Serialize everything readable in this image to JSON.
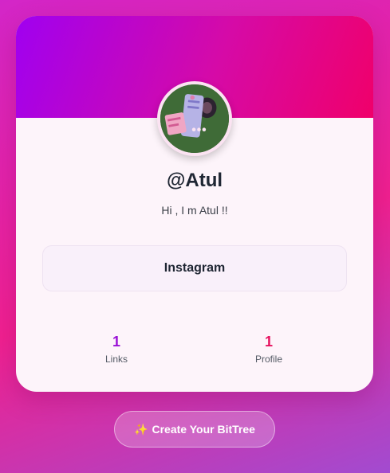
{
  "profile": {
    "username": "@Atul",
    "bio": "Hi , I m Atul !!"
  },
  "links": [
    {
      "label": "Instagram"
    }
  ],
  "stats": {
    "links": {
      "value": "1",
      "label": "Links"
    },
    "profile": {
      "value": "1",
      "label": "Profile"
    }
  },
  "cta": {
    "icon": "✨",
    "label": "Create Your BitTree"
  },
  "colors": {
    "banner_start": "#a000f0",
    "banner_end": "#f0006a",
    "links_stat": "#9a11d6",
    "profile_stat": "#e6115e"
  }
}
